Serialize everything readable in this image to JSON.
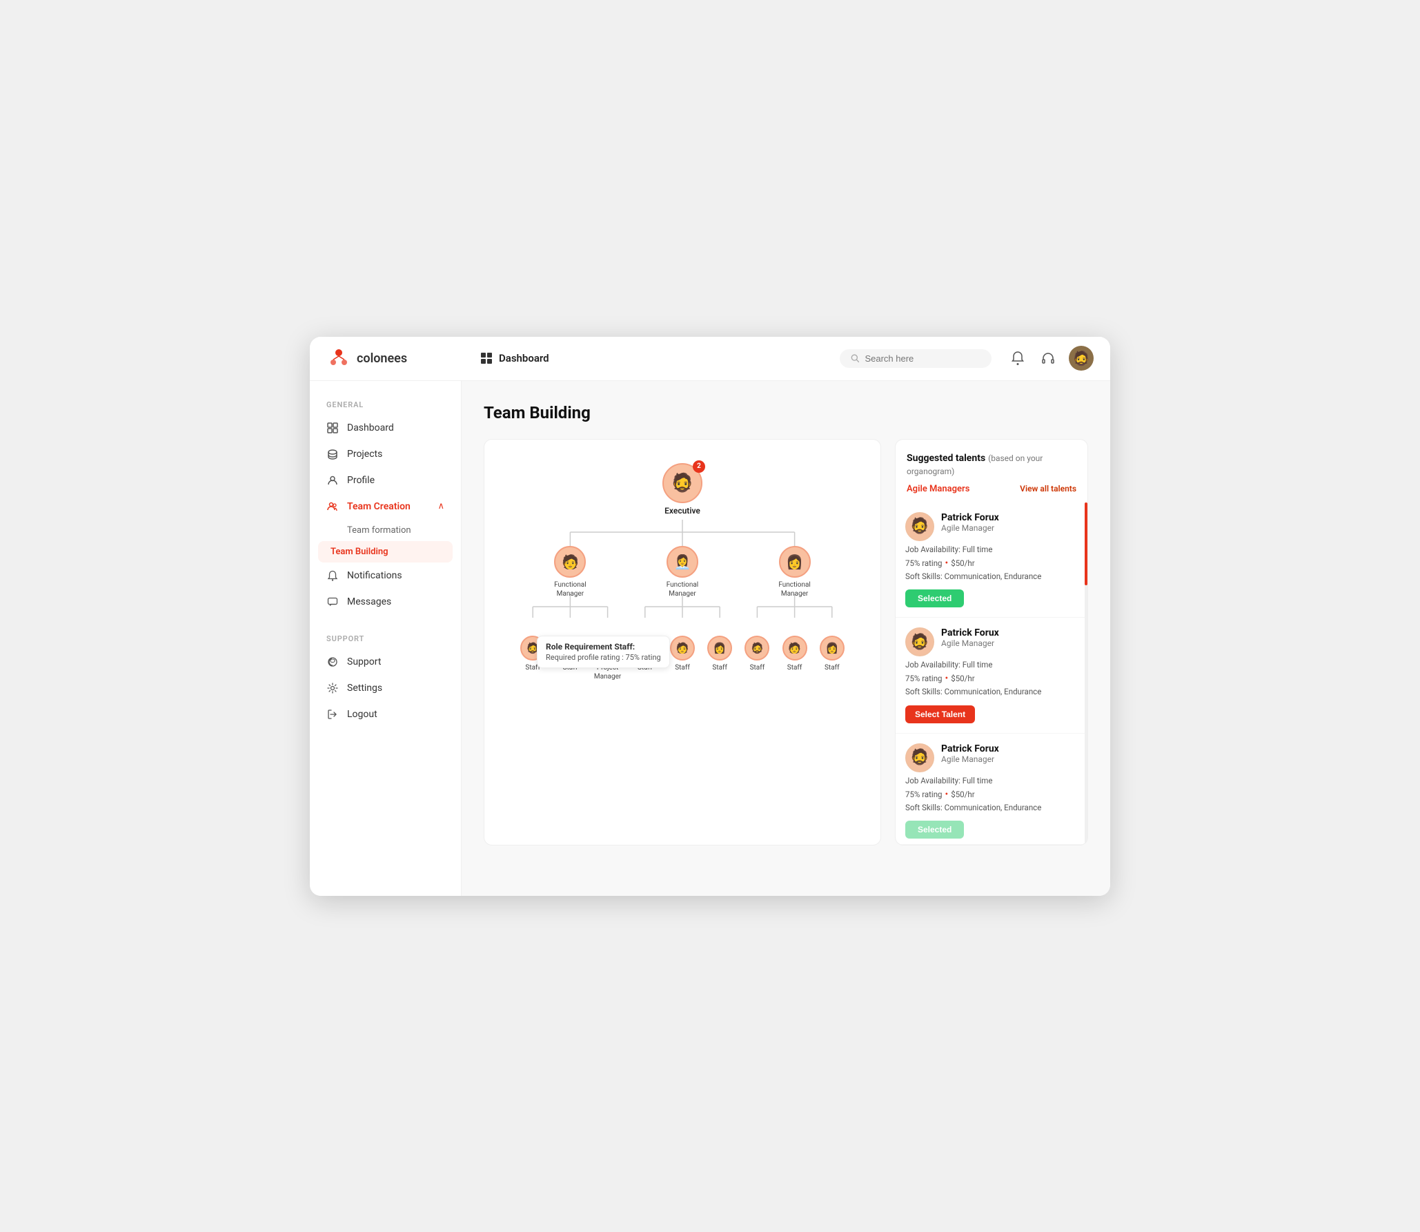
{
  "window": {
    "title": "colonees"
  },
  "header": {
    "logo_text": "colonees",
    "nav_item": "Dashboard",
    "search_placeholder": "Search here",
    "bell_icon": "bell",
    "headset_icon": "headset"
  },
  "sidebar": {
    "general_label": "GENERAL",
    "support_label": "SUPPORT",
    "items": [
      {
        "id": "dashboard",
        "label": "Dashboard",
        "icon": "grid"
      },
      {
        "id": "projects",
        "label": "Projects",
        "icon": "layers"
      },
      {
        "id": "profile",
        "label": "Profile",
        "icon": "user"
      }
    ],
    "team_creation": {
      "label": "Team Creation",
      "icon": "team",
      "subitems": [
        {
          "id": "team-formation",
          "label": "Team formation"
        },
        {
          "id": "team-building",
          "label": "Team Building",
          "active": true
        }
      ]
    },
    "notifications": {
      "label": "Notifications",
      "icon": "bell"
    },
    "messages": {
      "label": "Messages",
      "icon": "chat"
    },
    "support_items": [
      {
        "id": "support",
        "label": "Support",
        "icon": "headset"
      },
      {
        "id": "settings",
        "label": "Settings",
        "icon": "gear"
      },
      {
        "id": "logout",
        "label": "Logout",
        "icon": "logout"
      }
    ]
  },
  "main": {
    "page_title": "Team Building",
    "org_chart": {
      "executive_label": "Executive",
      "badge_count": "2",
      "managers": [
        {
          "label": "Functional Manager"
        },
        {
          "label": "Functional Manager"
        },
        {
          "label": "Functional Manager"
        }
      ],
      "staff_labels": [
        "Staff",
        "Staff",
        "Project Manager",
        "Staff",
        "Staff",
        "Staff",
        "Staff",
        "Staff",
        "Staff"
      ],
      "tooltip": {
        "title": "Role Requirement Staff:",
        "detail": "Required profile rating : 75% rating"
      }
    },
    "suggested_talents": {
      "title": "Suggested talents",
      "subtitle": "(based on your organogram)",
      "filter_label": "Agile Managers",
      "view_all_label": "View all talents",
      "cards": [
        {
          "name": "Patrick Forux",
          "role": "Agile Manager",
          "availability": "Job Availability: Full time",
          "rating": "75% rating",
          "rate": "$50/hr",
          "soft_skills": "Soft Skills: Communication, Endurance",
          "button_label": "Selected",
          "button_type": "selected"
        },
        {
          "name": "Patrick Forux",
          "role": "Agile Manager",
          "availability": "Job Availability: Full time",
          "rating": "75% rating",
          "rate": "$50/hr",
          "soft_skills": "Soft Skills: Communication, Endurance",
          "button_label": "Select Talent",
          "button_type": "select"
        },
        {
          "name": "Patrick Forux",
          "role": "Agile Manager",
          "availability": "Job Availability: Full time",
          "rating": "75% rating",
          "rate": "$50/hr",
          "soft_skills": "Soft Skills: Communication, Endurance",
          "button_label": "Selected",
          "button_type": "selected"
        }
      ]
    }
  }
}
